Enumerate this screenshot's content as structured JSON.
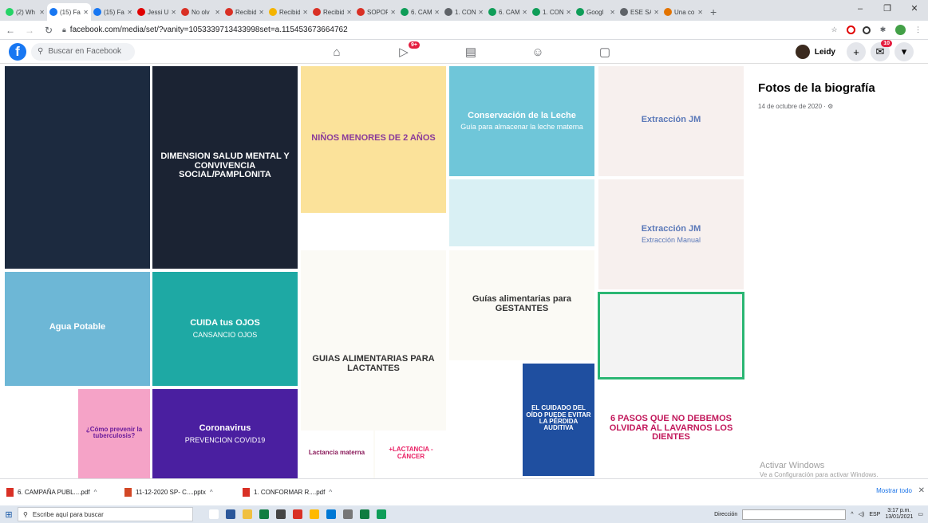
{
  "browser": {
    "tabs": [
      {
        "label": "(2) Wh",
        "color": "#25d366"
      },
      {
        "label": "(15) Fa",
        "color": "#1877f2",
        "active": true
      },
      {
        "label": "(15) Fa",
        "color": "#1877f2"
      },
      {
        "label": "Jessi U",
        "color": "#e00000"
      },
      {
        "label": "No olv",
        "color": "#d93025"
      },
      {
        "label": "Recibid",
        "color": "#d93025"
      },
      {
        "label": "Recibid",
        "color": "#f4b400"
      },
      {
        "label": "Recibid",
        "color": "#d93025"
      },
      {
        "label": "SOPOR",
        "color": "#d93025"
      },
      {
        "label": "6. CAM",
        "color": "#0f9d58"
      },
      {
        "label": "1. CON",
        "color": "#5f6368"
      },
      {
        "label": "6. CAM",
        "color": "#0f9d58"
      },
      {
        "label": "1. CON",
        "color": "#0f9d58"
      },
      {
        "label": "Googl",
        "color": "#0f9d58"
      },
      {
        "label": "ESE SA",
        "color": "#5f6368"
      },
      {
        "label": "Una co",
        "color": "#e37400"
      }
    ],
    "new_tab": "+",
    "url": "facebook.com/media/set/?vanity=1053339713433998set=a.115453673664762",
    "window_controls": [
      "–",
      "❐",
      "✕"
    ]
  },
  "fb": {
    "logo": "f",
    "search_placeholder": "Buscar en Facebook",
    "nav_icons": [
      "home-icon",
      "watch-icon",
      "marketplace-icon",
      "groups-icon",
      "gaming-icon"
    ],
    "watch_badge": "9+",
    "user_name": "Leidy",
    "notif_badge": "10"
  },
  "gallery": {
    "tiles": [
      {
        "title": "",
        "text": "",
        "bg": "#1c2a3f",
        "fg": "#ffffff"
      },
      {
        "title": "DIMENSION SALUD MENTAL Y CONVIVENCIA SOCIAL/PAMPLONITA",
        "text": "",
        "bg": "#1b2333",
        "fg": "#ffffff"
      },
      {
        "title": "NIÑOS MENORES DE 2 AÑOS",
        "text": "",
        "bg": "#fbe29a",
        "fg": "#8a3a9a"
      },
      {
        "title": "Conservación de la Leche",
        "text": "Guía para almacenar la leche materna",
        "bg": "#6fc6d9",
        "fg": "#ffffff"
      },
      {
        "title": "Extracción JM",
        "text": "",
        "bg": "#f7f0ee",
        "fg": "#5a78b8"
      },
      {
        "title": "",
        "text": "",
        "bg": "#d9f0f4",
        "fg": "#333"
      },
      {
        "title": "Extracción JM",
        "text": "Extracción Manual",
        "bg": "#f7f0ee",
        "fg": "#5a78b8"
      },
      {
        "title": "Agua Potable",
        "text": "",
        "bg": "#6db7d6",
        "fg": "#ffffff"
      },
      {
        "title": "CUIDA tus OJOS",
        "text": "CANSANCIO OJOS",
        "bg": "#1ea9a4",
        "fg": "#ffffff"
      },
      {
        "title": "GUIAS ALIMENTARIAS PARA LACTANTES",
        "text": "",
        "bg": "#fbfaf5",
        "fg": "#333"
      },
      {
        "title": "Guías alimentarias para GESTANTES",
        "text": "",
        "bg": "#fbfaf5",
        "fg": "#333"
      },
      {
        "title": "",
        "text": "",
        "bg": "#f3f3f3",
        "fg": "#333"
      },
      {
        "title": "",
        "text": "",
        "bg": "#ffffff",
        "fg": "#333"
      },
      {
        "title": "EL CUIDADO DEL OÍDO PUEDE EVITAR LA PÉRDIDA AUDITIVA",
        "text": "",
        "bg": "#1f4fa0",
        "fg": "#ffffff"
      },
      {
        "title": "6 PASOS QUE NO DEBEMOS OLVIDAR AL LAVARNOS LOS DIENTES",
        "text": "",
        "bg": "#fff",
        "fg": "#c2185b"
      },
      {
        "title": "",
        "text": "",
        "bg": "#fff",
        "fg": "#333"
      },
      {
        "title": "¿Cómo prevenir la tuberculosis?",
        "text": "",
        "bg": "#f5a3c7",
        "fg": "#6a1b9a"
      },
      {
        "title": "",
        "text": "",
        "bg": "#fbe5b5",
        "fg": "#333"
      },
      {
        "title": "Coronavirus",
        "text": "PREVENCION COVID19",
        "bg": "#4a1fa0",
        "fg": "#ffffff"
      },
      {
        "title": "Lactancia materna",
        "text": "",
        "bg": "#fff",
        "fg": "#8a1a5a"
      },
      {
        "title": "+LACTANCIA -CÁNCER",
        "text": "",
        "bg": "#fff",
        "fg": "#e91e63"
      }
    ]
  },
  "sidebar": {
    "title": "Fotos de la biografía",
    "date": "14 de octubre de 2020 · ⚙"
  },
  "watermark": {
    "line1": "Activar Windows",
    "line2": "Ve a Configuración para activar Windows."
  },
  "downloads": {
    "items": [
      {
        "name": "6. CAMPAÑA PUBL....pdf",
        "color": "#d93025"
      },
      {
        "name": "11-12-2020 SP- C....pptx",
        "color": "#d24726"
      },
      {
        "name": "1. CONFORMAR R....pdf",
        "color": "#d93025"
      }
    ],
    "show_all": "Mostrar todo",
    "close": "✕"
  },
  "taskbar": {
    "search": "Escribe aquí para buscar",
    "address_label": "Dirección",
    "lang": "ESP",
    "time": "3:17 p.m.",
    "date": "13/01/2021",
    "app_colors": [
      "#ffffff",
      "#2b579a",
      "#f0c040",
      "#107c41",
      "#444",
      "#d93025",
      "#ffb900",
      "#0078d4",
      "#777",
      "#107c41",
      "#0f9d58"
    ]
  }
}
